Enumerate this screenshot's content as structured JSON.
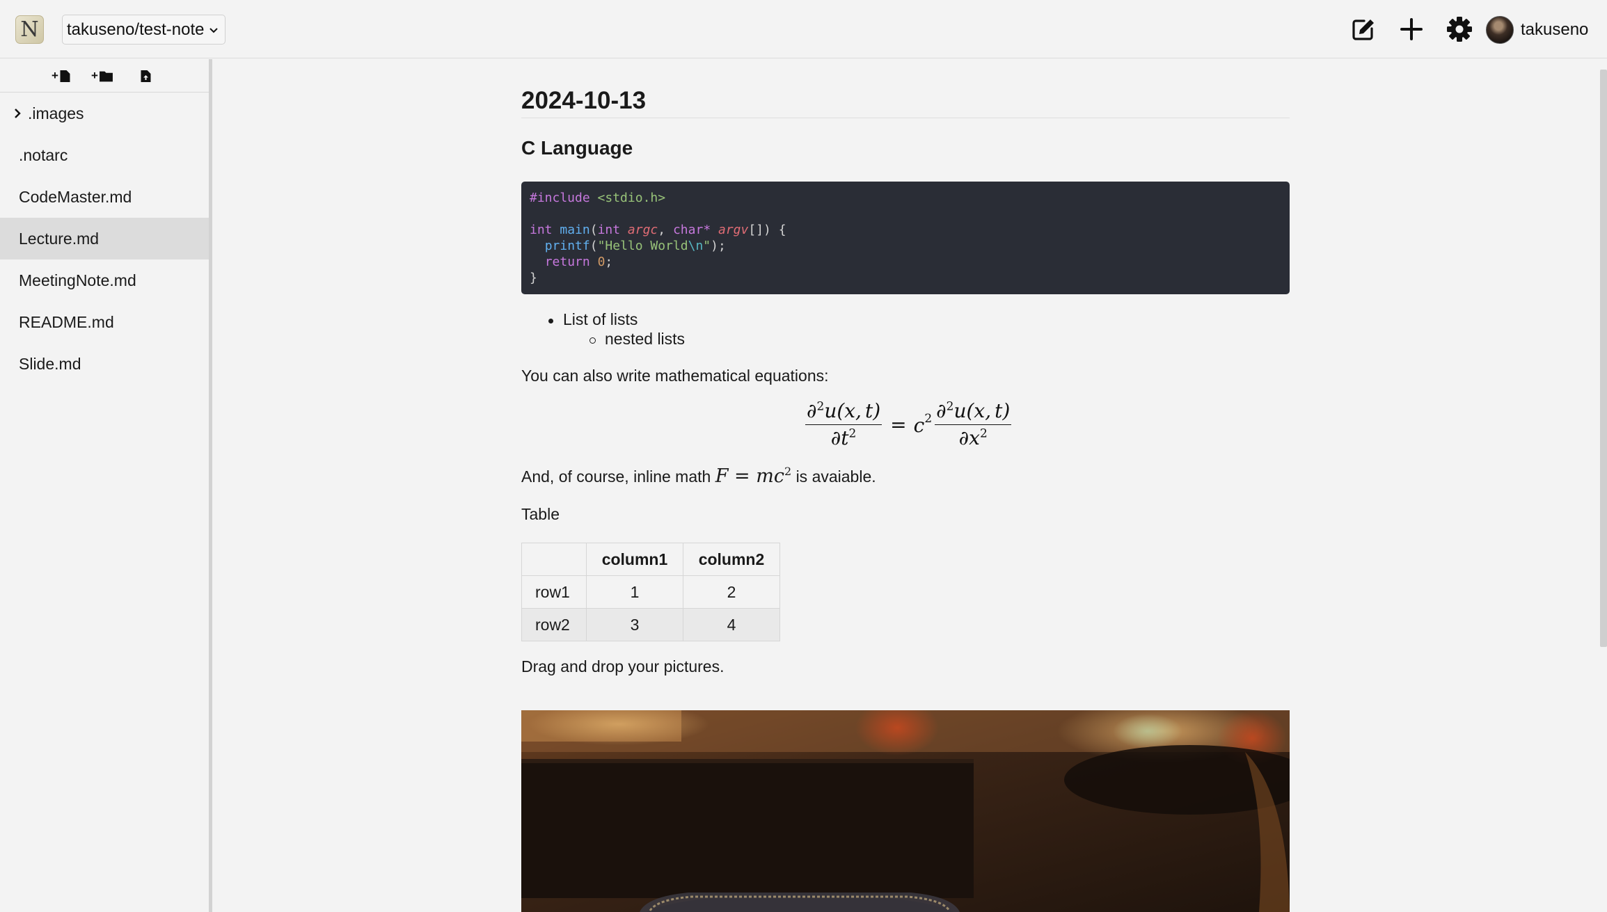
{
  "header": {
    "repo": "takuseno/test-note",
    "user_name": "takuseno",
    "logo_letter": "N",
    "icons": [
      "edit-icon",
      "plus-icon",
      "gear-icon"
    ]
  },
  "sidebar": {
    "toolbar": [
      {
        "name": "new-file",
        "prefix": "+"
      },
      {
        "name": "new-folder",
        "prefix": "+"
      },
      {
        "name": "upload-file",
        "prefix": ""
      }
    ],
    "items": [
      {
        "label": ".images",
        "type": "folder"
      },
      {
        "label": ".notarc",
        "type": "file"
      },
      {
        "label": "CodeMaster.md",
        "type": "file"
      },
      {
        "label": "Lecture.md",
        "type": "file",
        "active": true
      },
      {
        "label": "MeetingNote.md",
        "type": "file"
      },
      {
        "label": "README.md",
        "type": "file"
      },
      {
        "label": "Slide.md",
        "type": "file"
      }
    ]
  },
  "doc": {
    "title": "2024-10-13",
    "section": "C Language",
    "code": {
      "lines": [
        "#include <stdio.h>",
        "",
        "int main(int argc, char* argv[]) {",
        "  printf(\"Hello World\\n\");",
        "  return 0;",
        "}"
      ]
    },
    "list": {
      "item": "List of lists",
      "nested": "nested lists"
    },
    "math_intro": "You can also write mathematical equations:",
    "inline_prefix": "And, of course, inline math",
    "inline_suffix": "is avaiable.",
    "table_caption": "Table",
    "table": {
      "headers": [
        "",
        "column1",
        "column2"
      ],
      "rows": [
        [
          "row1",
          "1",
          "2"
        ],
        [
          "row2",
          "3",
          "4"
        ]
      ]
    },
    "drag_text": "Drag and drop your pictures."
  },
  "colors": {
    "background": "#f3f3f3",
    "code_bg": "#2a2d36",
    "active_item": "#dcdcdc"
  }
}
